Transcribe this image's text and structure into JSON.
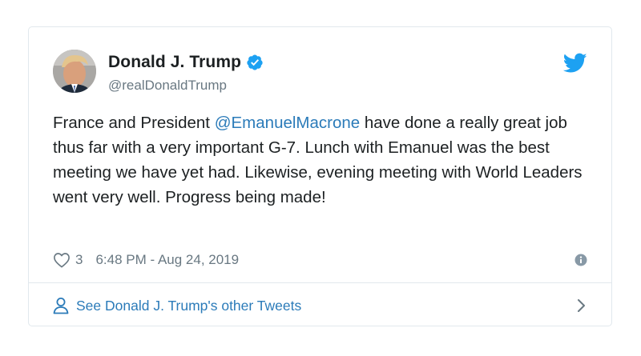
{
  "tweet": {
    "author": {
      "display_name": "Donald J. Trump",
      "handle": "@realDonaldTrump",
      "verified": true
    },
    "text_parts": {
      "before_mention": "France and President ",
      "mention": "@EmanuelMacrone",
      "after_mention": " have done a really great job thus far with a very important G-7. Lunch with Emanuel was the best meeting we have yet had. Likewise, evening meeting with World Leaders went very well. Progress being made!"
    },
    "like_count": "3",
    "timestamp": "6:48 PM - Aug 24, 2019",
    "footer_link": "See Donald J. Trump's other Tweets"
  },
  "icons": {
    "verified": "verified-badge-icon",
    "brand": "twitter-bird-icon",
    "like": "heart-icon",
    "info": "info-icon",
    "profile": "person-icon",
    "next": "chevron-right-icon"
  },
  "colors": {
    "link_blue": "#2b7bb9",
    "twitter_blue": "#1da1f2",
    "muted_text": "#697882",
    "border": "#e1e8ed",
    "text": "#1c2022"
  }
}
